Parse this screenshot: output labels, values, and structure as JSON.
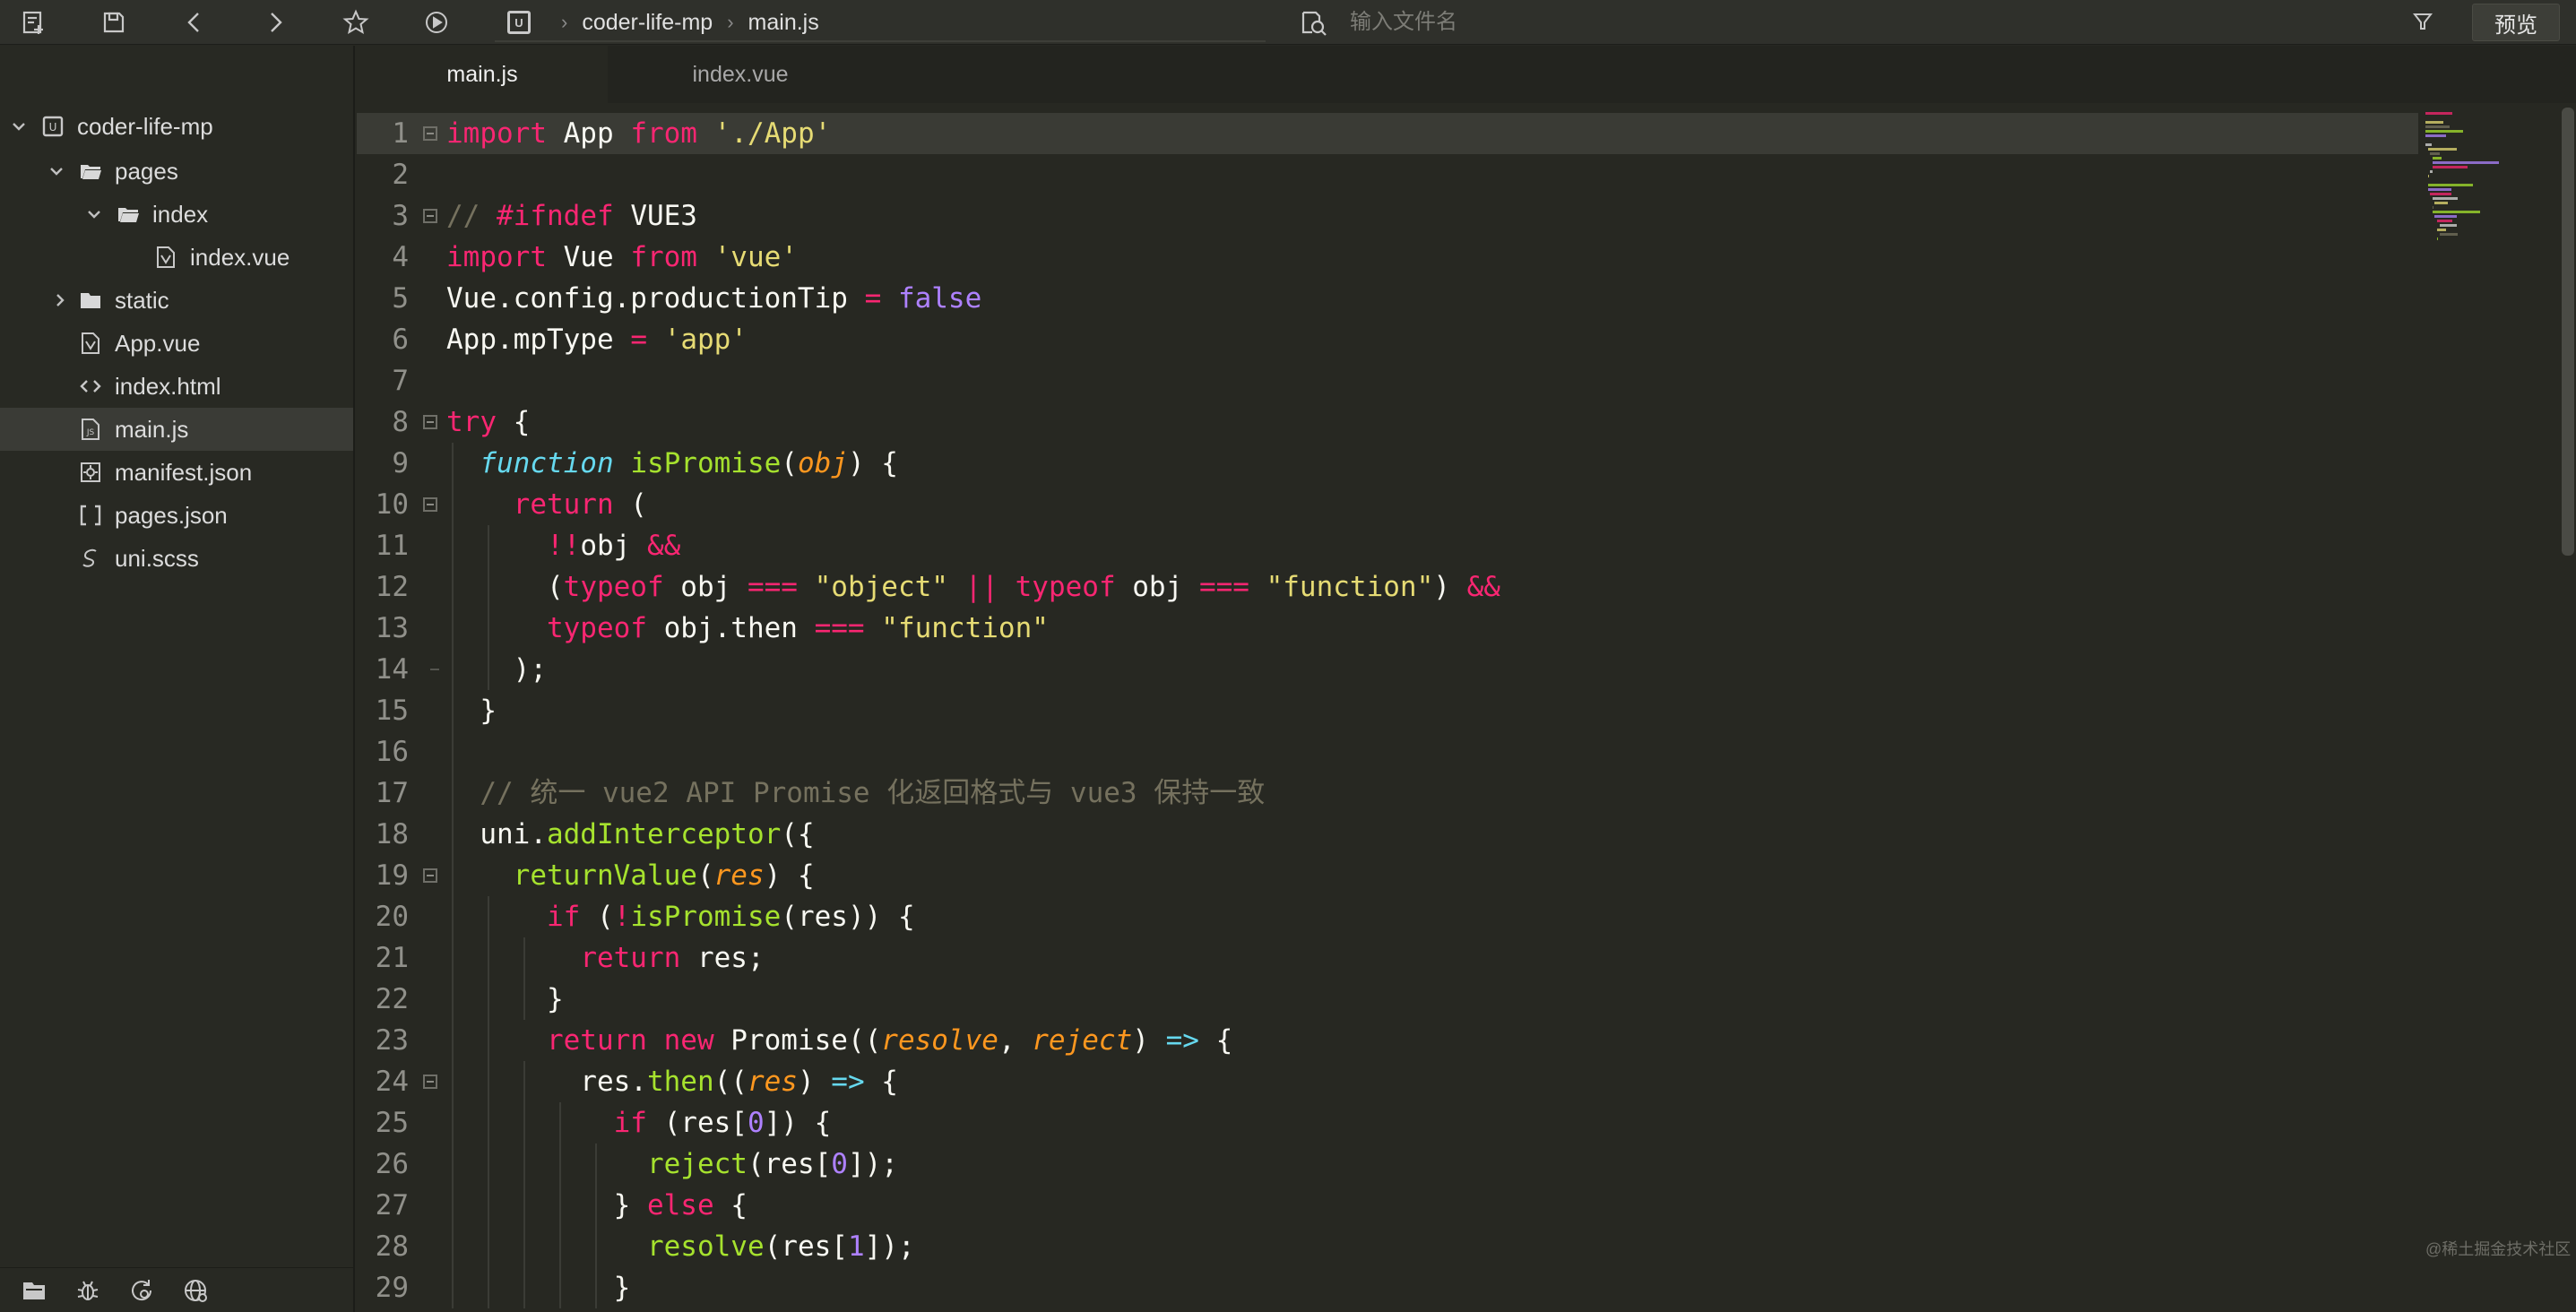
{
  "toolbar": {
    "icons": [
      "new-file-icon",
      "save-icon",
      "back-icon",
      "forward-icon",
      "star-icon",
      "run-icon"
    ],
    "breadcrumb": [
      "coder-life-mp",
      "main.js"
    ],
    "project_badge": "U",
    "search_placeholder": "输入文件名",
    "preview_label": "预览"
  },
  "sidebar": {
    "items": [
      {
        "label": "coder-life-mp"
      },
      {
        "label": "pages"
      },
      {
        "label": "index"
      },
      {
        "label": "index.vue"
      },
      {
        "label": "static"
      },
      {
        "label": "App.vue"
      },
      {
        "label": "index.html"
      },
      {
        "label": "main.js"
      },
      {
        "label": "manifest.json"
      },
      {
        "label": "pages.json"
      },
      {
        "label": "uni.scss"
      }
    ],
    "footer_icons": [
      "folder-icon",
      "bug-icon",
      "refresh-globe-icon",
      "browser-icon"
    ]
  },
  "tabs": [
    {
      "label": "main.js"
    },
    {
      "label": "index.vue"
    }
  ],
  "colors": {
    "background": "#272822",
    "keyword": "#f92672",
    "string": "#e6db74",
    "comment": "#75715e",
    "number": "#ae81ff",
    "function": "#a6e22e",
    "storage": "#66d9ef",
    "parameter": "#fd971f"
  },
  "code_lines": [
    {
      "n": "1",
      "html": "<span class=\"k\">import</span> App <span class=\"k\">from</span> <span class=\"s\">'./App'</span>"
    },
    {
      "n": "2",
      "html": ""
    },
    {
      "n": "3",
      "html": "<span class=\"c\">//</span> <span class=\"k\">#ifndef</span> VUE3"
    },
    {
      "n": "4",
      "html": "<span class=\"k\">import</span> Vue <span class=\"k\">from</span> <span class=\"s\">'vue'</span>"
    },
    {
      "n": "5",
      "html": "Vue.config.productionTip <span class=\"op\">=</span> <span class=\"n\">false</span>"
    },
    {
      "n": "6",
      "html": "App.mpType <span class=\"op\">=</span> <span class=\"s\">'app'</span>"
    },
    {
      "n": "7",
      "html": ""
    },
    {
      "n": "8",
      "html": "<span class=\"k\">try</span> {"
    },
    {
      "n": "9",
      "html": "  <span class=\"fn\">function</span> <span class=\"f\">isPromise</span>(<span class=\"p\">obj</span>) {"
    },
    {
      "n": "10",
      "html": "    <span class=\"k\">return</span> ("
    },
    {
      "n": "11",
      "html": "      <span class=\"op\">!!</span>obj <span class=\"op\">&amp;&amp;</span>"
    },
    {
      "n": "12",
      "html": "      (<span class=\"k\">typeof</span> obj <span class=\"op\">===</span> <span class=\"s\">\"object\"</span> <span class=\"op\">||</span> <span class=\"k\">typeof</span> obj <span class=\"op\">===</span> <span class=\"s\">\"function\"</span>) <span class=\"op\">&amp;&amp;</span>"
    },
    {
      "n": "13",
      "html": "      <span class=\"k\">typeof</span> obj.then <span class=\"op\">===</span> <span class=\"s\">\"function\"</span>"
    },
    {
      "n": "14",
      "html": "    );"
    },
    {
      "n": "15",
      "html": "  }"
    },
    {
      "n": "16",
      "html": ""
    },
    {
      "n": "17",
      "html": "  <span class=\"c\">// 统一 vue2 API Promise 化返回格式与 vue3 保持一致</span>"
    },
    {
      "n": "18",
      "html": "  uni.<span class=\"f\">addInterceptor</span>({"
    },
    {
      "n": "19",
      "html": "    <span class=\"f\">returnValue</span>(<span class=\"p\">res</span>) {"
    },
    {
      "n": "20",
      "html": "      <span class=\"k\">if</span> (<span class=\"op\">!</span><span class=\"f\">isPromise</span>(res)) {"
    },
    {
      "n": "21",
      "html": "        <span class=\"k\">return</span> res;"
    },
    {
      "n": "22",
      "html": "      }"
    },
    {
      "n": "23",
      "html": "      <span class=\"k\">return</span> <span class=\"k\">new</span> Promise((<span class=\"p\">resolve</span>, <span class=\"p\">reject</span>) <span class=\"ar\">=&gt;</span> {"
    },
    {
      "n": "24",
      "html": "        res.<span class=\"f\">then</span>((<span class=\"p\">res</span>) <span class=\"ar\">=&gt;</span> {"
    },
    {
      "n": "25",
      "html": "          <span class=\"k\">if</span> (res[<span class=\"n\">0</span>]) {"
    },
    {
      "n": "26",
      "html": "            <span class=\"f\">reject</span>(res[<span class=\"n\">0</span>]);"
    },
    {
      "n": "27",
      "html": "          } <span class=\"k\">else</span> {"
    },
    {
      "n": "28",
      "html": "            <span class=\"f\">resolve</span>(res[<span class=\"n\">1</span>]);"
    },
    {
      "n": "29",
      "html": "          }"
    }
  ],
  "watermark": "@稀土掘金技术社区"
}
